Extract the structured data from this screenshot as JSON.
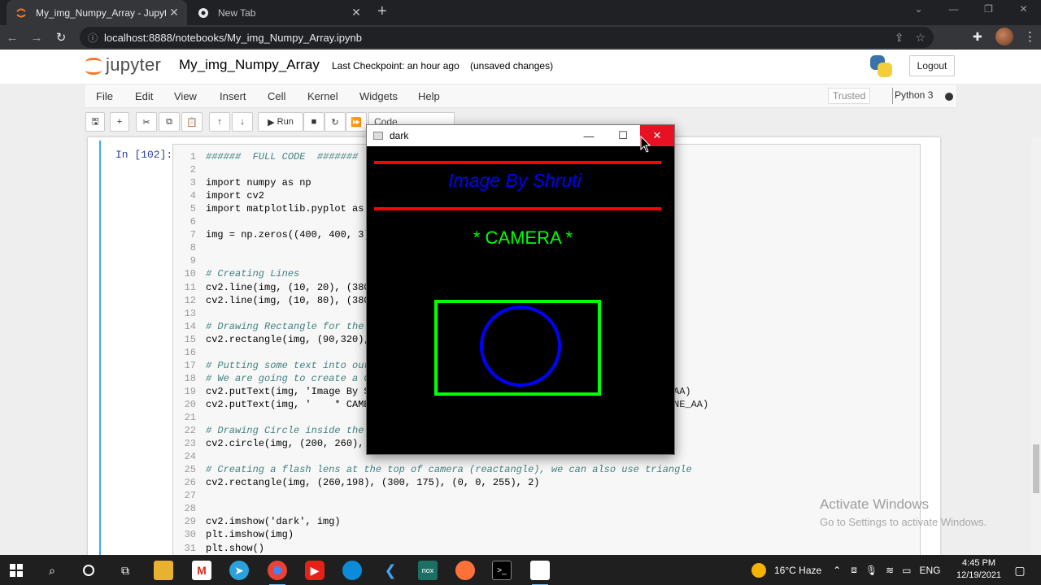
{
  "browser": {
    "tabs": [
      {
        "title": "My_img_Numpy_Array - Jupyter",
        "icon": "jupyter-favicon",
        "active": true
      },
      {
        "title": "New Tab",
        "icon": "chrome-icon",
        "active": false
      }
    ],
    "url": "localhost:8888/notebooks/My_img_Numpy_Array.ipynb"
  },
  "jupyter": {
    "logo_text": "jupyter",
    "notebook_name": "My_img_Numpy_Array",
    "checkpoint": "Last Checkpoint: an hour ago",
    "unsaved": "(unsaved changes)",
    "logout_label": "Logout",
    "menu": [
      "File",
      "Edit",
      "View",
      "Insert",
      "Cell",
      "Kernel",
      "Widgets",
      "Help"
    ],
    "trusted": "Trusted",
    "kernel": "Python 3",
    "toolbar": {
      "run_label": "Run",
      "cell_type": "Code"
    }
  },
  "cell": {
    "prompt": "In [102]:",
    "lines": [
      {
        "n": "1",
        "code": "######  FULL CODE  #######"
      },
      {
        "n": "2",
        "code": ""
      },
      {
        "n": "3",
        "code": "import numpy as np"
      },
      {
        "n": "4",
        "code": "import cv2"
      },
      {
        "n": "5",
        "code": "import matplotlib.pyplot as"
      },
      {
        "n": "6",
        "code": ""
      },
      {
        "n": "7",
        "code": "img = np.zeros((400, 400, 3)"
      },
      {
        "n": "8",
        "code": ""
      },
      {
        "n": "9",
        "code": ""
      },
      {
        "n": "10",
        "code": "# Creating Lines"
      },
      {
        "n": "11",
        "code": "cv2.line(img, (10, 20), (380"
      },
      {
        "n": "12",
        "code": "cv2.line(img, (10, 80), (380"
      },
      {
        "n": "13",
        "code": ""
      },
      {
        "n": "14",
        "code": "# Drawing Rectangle for the"
      },
      {
        "n": "15",
        "code": "cv2.rectangle(img, (90,320),"
      },
      {
        "n": "16",
        "code": ""
      },
      {
        "n": "17",
        "code": "# Putting some text into our"
      },
      {
        "n": "18",
        "code": "# We are going to create a C"
      },
      {
        "n": "19",
        "code": "cv2.putText(img, 'Image By S"
      },
      {
        "n": "20",
        "code": "cv2.putText(img, '    * CAMER"
      },
      {
        "n": "21",
        "code": ""
      },
      {
        "n": "22",
        "code": "# Drawing Circle inside the"
      },
      {
        "n": "23",
        "code": "cv2.circle(img, (200, 260),"
      },
      {
        "n": "24",
        "code": ""
      },
      {
        "n": "25",
        "code": "# Creating a flash lens at the top of camera (reactangle), we can also use triangle"
      },
      {
        "n": "26",
        "code": "cv2.rectangle(img, (260,198), (300, 175), (0, 0, 255), 2)"
      },
      {
        "n": "27",
        "code": ""
      },
      {
        "n": "28",
        "code": ""
      },
      {
        "n": "29",
        "code": "cv2.imshow('dark', img)"
      },
      {
        "n": "30",
        "code": "plt.imshow(img)"
      },
      {
        "n": "31",
        "code": "plt.show()"
      }
    ],
    "overflow_19": "AA)",
    "overflow_20": "NE_AA)"
  },
  "cv_window": {
    "title": "dark",
    "text_top": "Image By Shruti",
    "text_camera": "* CAMERA *"
  },
  "watermark": {
    "title": "Activate Windows",
    "subtitle": "Go to Settings to activate Windows."
  },
  "taskbar": {
    "weather": "16°C  Haze",
    "lang": "ENG",
    "time": "4:45 PM",
    "date": "12/19/2021"
  },
  "colors": {
    "jupyter_orange": "#f37726",
    "cell_border": "#42a5f5",
    "cv_red": "#ff0000",
    "cv_blue": "#0000ff",
    "cv_green": "#00ff00",
    "close_red": "#e81123"
  }
}
